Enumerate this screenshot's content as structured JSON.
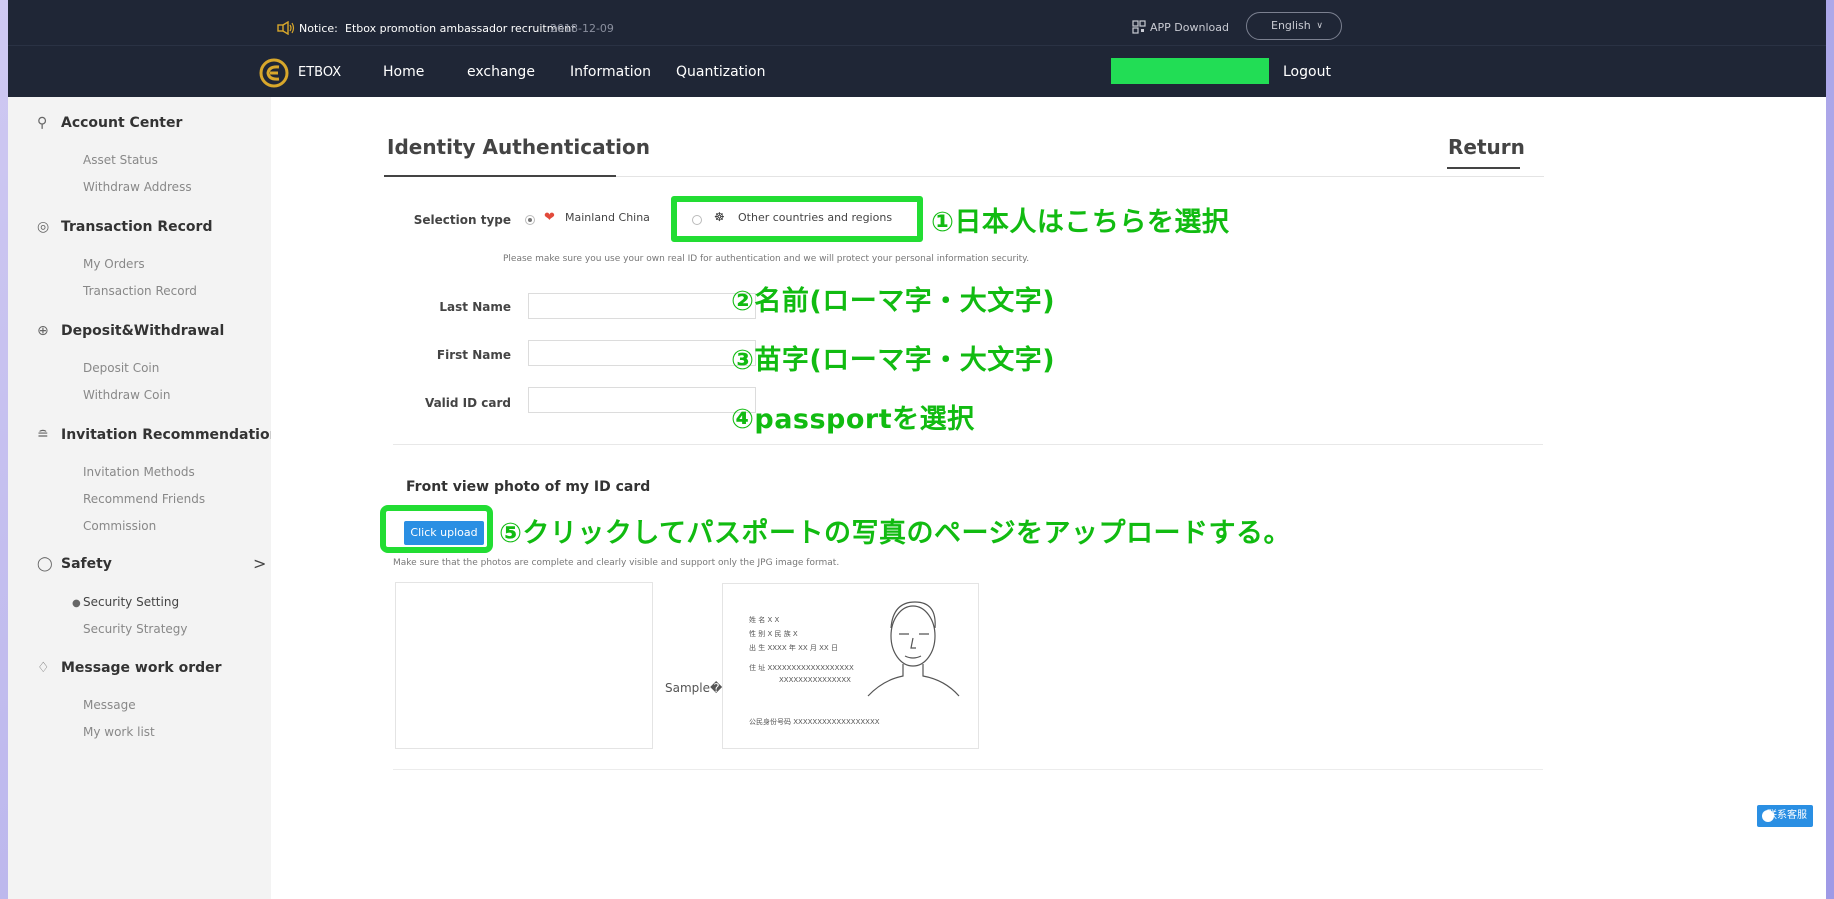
{
  "notice": {
    "label": "Notice:",
    "text": "Etbox promotion ambassador recruitment",
    "date": "2018-12-09",
    "app_download": "APP Download",
    "language": "English"
  },
  "nav": {
    "brand": "ETBOX",
    "links": [
      "Home",
      "exchange",
      "Information",
      "Quantization"
    ],
    "logout": "Logout"
  },
  "sidebar": {
    "groups": [
      {
        "title": "Account Center",
        "icon": "user-icon",
        "items": [
          "Asset Status",
          "Withdraw Address"
        ]
      },
      {
        "title": "Transaction Record",
        "icon": "record-icon",
        "items": [
          "My Orders",
          "Transaction Record"
        ]
      },
      {
        "title": "Deposit&Withdrawal",
        "icon": "deposit-icon",
        "items": [
          "Deposit Coin",
          "Withdraw Coin"
        ]
      },
      {
        "title": "Invitation Recommendation",
        "icon": "share-icon",
        "items": [
          "Invitation Methods",
          "Recommend Friends",
          "Commission"
        ]
      },
      {
        "title": "Safety",
        "icon": "shield-icon",
        "items": [
          "Security Setting",
          "Security Strategy"
        ]
      },
      {
        "title": "Message work order",
        "icon": "bell-icon",
        "items": [
          "Message",
          "My work list"
        ]
      }
    ],
    "safety_chevron": ">"
  },
  "main": {
    "title": "Identity Authentication",
    "return": "Return",
    "selection_type_label": "Selection type",
    "option_mainland": "Mainland China",
    "option_other": "Other countries and regions",
    "privacy_hint": "Please make sure you use your own real ID for authentication and we will protect your personal information security.",
    "last_name_label": "Last Name",
    "first_name_label": "First Name",
    "valid_id_label": "Valid ID card",
    "front_title": "Front view photo of my ID card",
    "upload_button": "Click upload",
    "upload_hint": "Make sure that the photos are complete and clearly visible and support only the JPG image format.",
    "sample_label": "Sample�",
    "contact": "联系客服"
  },
  "annotations": {
    "a1": "①日本人はこちらを選択",
    "a2": "②名前(ローマ字・大文字)",
    "a3": "③苗字(ローマ字・大文字)",
    "a4": "④passportを選択",
    "a5": "⑤クリックしてパスポートの写真のページをアップロードする。"
  },
  "sample_card": {
    "lines": [
      "姓 名 X X",
      "性 别 X  民 族 X",
      "出 生 XXXX 年 XX 月 XX 日",
      "住 址 XXXXXXXXXXXXXXXXXX",
      "XXXXXXXXXXXXXXX",
      "公民身份号码 XXXXXXXXXXXXXXXXXX"
    ]
  },
  "colors": {
    "header_bg": "#1f2636",
    "highlight": "#22dd33",
    "annotation": "#11bb11",
    "accent": "#2a8fe3"
  }
}
